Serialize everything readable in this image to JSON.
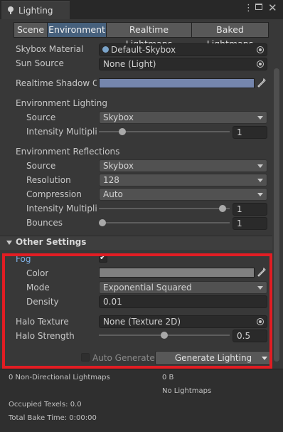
{
  "window": {
    "title": "Lighting"
  },
  "tabs": [
    "Scene",
    "Environment",
    "Realtime Lightmaps",
    "Baked Lightmaps"
  ],
  "scene": {
    "skybox_material": {
      "label": "Skybox Material",
      "value": "Default-Skybox"
    },
    "sun_source": {
      "label": "Sun Source",
      "value": "None (Light)"
    },
    "realtime_shadow_color": {
      "label": "Realtime Shadow Co"
    }
  },
  "environment_lighting": {
    "header": "Environment Lighting",
    "source": {
      "label": "Source",
      "value": "Skybox"
    },
    "intensity": {
      "label": "Intensity Multiplie",
      "value": "1",
      "slider_fraction": 0.16
    }
  },
  "environment_reflections": {
    "header": "Environment Reflections",
    "source": {
      "label": "Source",
      "value": "Skybox"
    },
    "resolution": {
      "label": "Resolution",
      "value": "128"
    },
    "compression": {
      "label": "Compression",
      "value": "Auto"
    },
    "intensity": {
      "label": "Intensity Multiplie",
      "value": "1",
      "slider_fraction": 0.97
    },
    "bounces": {
      "label": "Bounces",
      "value": "1",
      "slider_fraction": 0.0
    }
  },
  "other_settings": {
    "header": "Other Settings",
    "fog": {
      "label": "Fog",
      "checked": "✔"
    },
    "color": {
      "label": "Color"
    },
    "mode": {
      "label": "Mode",
      "value": "Exponential Squared"
    },
    "density": {
      "label": "Density",
      "value": "0.01"
    },
    "halo_texture": {
      "label": "Halo Texture",
      "value": "None (Texture 2D)"
    },
    "halo_strength": {
      "label": "Halo Strength",
      "value": "0.5",
      "slider_fraction": 0.5
    }
  },
  "generate": {
    "auto_label": "Auto Generate",
    "button_label": "Generate Lighting"
  },
  "stats": {
    "lightmaps": "0 Non-Directional Lightmaps",
    "size": "0 B",
    "no_lightmaps": "No Lightmaps",
    "occupied": "Occupied Texels: 0.0",
    "bake_time": "Total Bake Time: 0:00:00"
  },
  "colors": {
    "shadow_color": "#7586ad",
    "fog_color": "#808080",
    "accent": "#46607c",
    "highlight": "#e11d23"
  }
}
